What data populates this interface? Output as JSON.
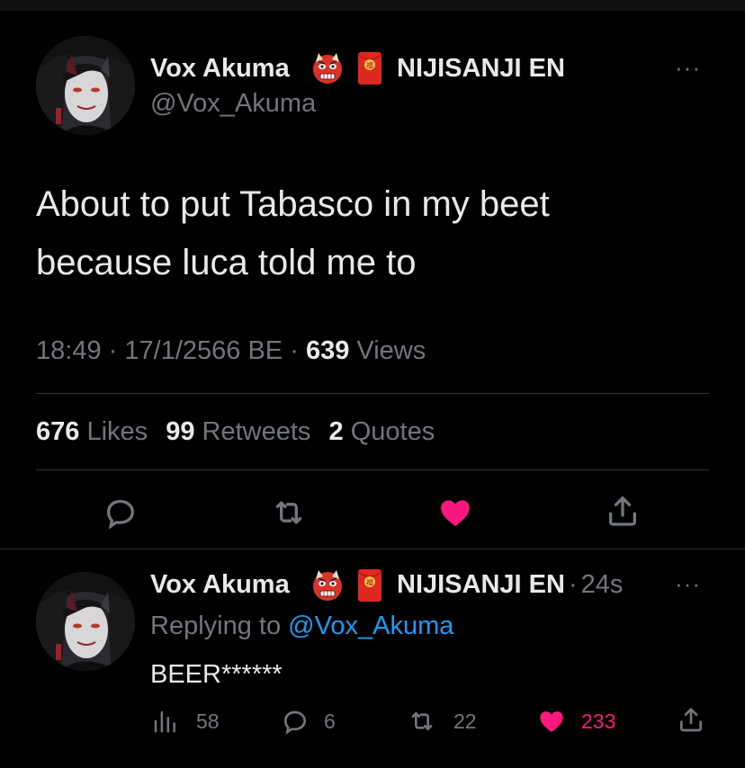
{
  "colors": {
    "background": "#000000",
    "text": "#e7e9ea",
    "secondary": "#71767b",
    "divider": "#2f3336",
    "like": "#f91880",
    "link": "#1d9bf0"
  },
  "main_tweet": {
    "author_name": "Vox Akuma",
    "badges": [
      "oni-mask-emoji",
      "red-envelope-emoji"
    ],
    "affiliation": "NIJISANJI EN",
    "handle": "@Vox_Akuma",
    "text_line1": "About to put Tabasco in my beet",
    "text_line2": "because luca told me to",
    "time": "18:49",
    "separator": "·",
    "date": "17/1/2566 BE",
    "views_count": "639",
    "views_label": "Views",
    "stats": {
      "likes_count": "676",
      "likes_label": "Likes",
      "retweets_count": "99",
      "retweets_label": "Retweets",
      "quotes_count": "2",
      "quotes_label": "Quotes"
    },
    "actions": [
      "reply-icon",
      "retweet-icon",
      "like-icon-filled",
      "share-icon"
    ],
    "more_label": "···"
  },
  "reply_tweet": {
    "author_name": "Vox Akuma",
    "badges": [
      "oni-mask-emoji",
      "red-envelope-emoji"
    ],
    "affiliation": "NIJISANJI EN",
    "separator": "·",
    "time_ago": "24s",
    "replying_prefix": "Replying to",
    "replying_handle": "@Vox_Akuma",
    "text": "BEER******",
    "views_count": "58",
    "replies_count": "6",
    "retweets_count": "22",
    "likes_count": "233",
    "more_label": "···"
  }
}
